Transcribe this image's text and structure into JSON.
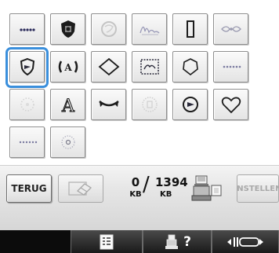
{
  "frame_pattern_grid": {
    "tiles": [
      {
        "icon": "dotted-line-pattern-icon"
      },
      {
        "icon": "shield-crest-pattern-icon"
      },
      {
        "icon": "faded-circle-pattern-icon"
      },
      {
        "icon": "script-signature-pattern-icon"
      },
      {
        "icon": "rectangle-outline-pattern-icon"
      },
      {
        "icon": "bow-ornament-pattern-icon"
      },
      {
        "icon": "shield-badge-pattern-icon",
        "selected": true
      },
      {
        "icon": "laurel-letter-a-pattern-icon"
      },
      {
        "icon": "diamond-outline-pattern-icon"
      },
      {
        "icon": "stitched-box-pattern-icon"
      },
      {
        "icon": "octagon-outline-pattern-icon"
      },
      {
        "icon": "dotted-row-pattern-icon"
      },
      {
        "icon": "faded-dotted-circle-pattern-icon"
      },
      {
        "icon": "outline-letter-a-pattern-icon"
      },
      {
        "icon": "ribbon-pattern-icon"
      },
      {
        "icon": "faded-medallion-pattern-icon"
      },
      {
        "icon": "circle-badge-pattern-icon"
      },
      {
        "icon": "heart-outline-pattern-icon"
      },
      {
        "icon": "dotted-row-small-pattern-icon"
      },
      {
        "icon": "dotted-circle-pattern-icon"
      }
    ],
    "selection_color": "#3a8fdc"
  },
  "toolbar": {
    "back_label": "TERUG",
    "eraser_icon": "eraser-icon",
    "memory": {
      "used": "0",
      "total": "1394",
      "unit": "KB"
    },
    "machine_icon": "embroidery-machine-icon",
    "set_label": "INSTELLEN",
    "set_enabled": false
  },
  "bottom_bar": {
    "buttons": [
      {
        "icon": "page-list-icon"
      },
      {
        "icon": "machine-help-icon",
        "label": "?"
      },
      {
        "icon": "presser-foot-icon"
      }
    ]
  }
}
